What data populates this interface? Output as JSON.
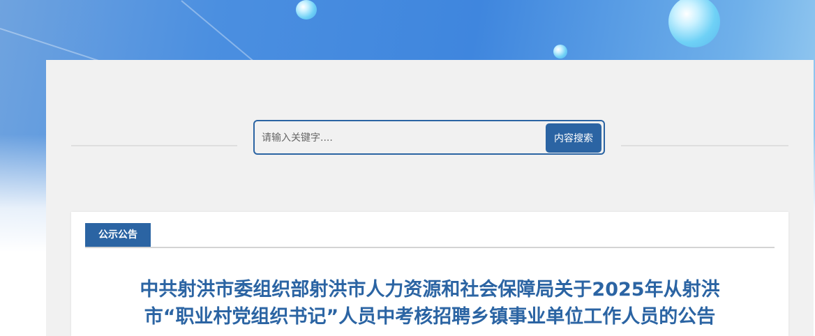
{
  "search": {
    "placeholder": "请输入关键字....",
    "button_label": "内容搜索"
  },
  "section": {
    "tab_label": "公示公告"
  },
  "article": {
    "title_line1": "中共射洪市委组织部射洪市人力资源和社会保障局关于2025年从射洪",
    "title_line2": "市“职业村党组织书记”人员中考核招聘乡镇事业单位工作人员的公告"
  },
  "colors": {
    "brand_blue": "#2b64a3",
    "panel_gray": "#f1f1f1"
  }
}
